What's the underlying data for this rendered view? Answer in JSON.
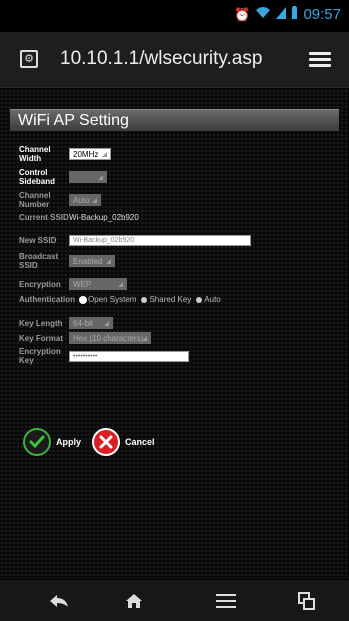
{
  "statusbar": {
    "time": "09:57"
  },
  "browser": {
    "url": "10.10.1.1/wlsecurity.asp"
  },
  "page": {
    "title": "WiFi AP Setting",
    "channel_width": {
      "label": "Channel Width",
      "value": "20MHz"
    },
    "control_sideband": {
      "label": "Control Sideband",
      "value": ""
    },
    "channel_number": {
      "label": "Channel Number",
      "value": "Auto"
    },
    "current_ssid": {
      "label": "Current SSID",
      "value": "Wi-Backup_02b920"
    },
    "new_ssid": {
      "label": "New SSID",
      "placeholder": "Wi-Backup_02b920"
    },
    "broadcast_ssid": {
      "label": "Broadcast SSID",
      "value": "Enabled"
    },
    "encryption": {
      "label": "Encryption",
      "value": "WEP"
    },
    "authentication": {
      "label": "Authentication",
      "options": [
        "Open System",
        "Shared Key",
        "Auto"
      ]
    },
    "key_length": {
      "label": "Key Length",
      "value": "64-bit"
    },
    "key_format": {
      "label": "Key Format",
      "value": "Hex (10 characters)"
    },
    "encryption_key": {
      "label": "Encryption Key",
      "value": "••••••••••"
    },
    "apply_label": "Apply",
    "cancel_label": "Cancel"
  },
  "colors": {
    "accent": "#39a8e0",
    "apply_green": "#2fa32f",
    "cancel_red": "#d81f26"
  }
}
